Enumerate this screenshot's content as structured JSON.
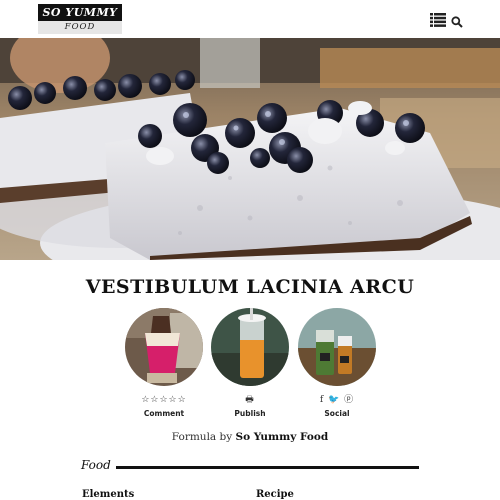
{
  "header": {
    "logo_top": "SO YUMMY",
    "logo_bottom": "FOOD",
    "menu_icon": "list-menu-icon",
    "search_icon": "search-icon"
  },
  "hero": {
    "image": "blueberry-cheesecake-slice-photo"
  },
  "post": {
    "title": "VESTIBULUM LACINIA ARCU"
  },
  "thumbnails": [
    {
      "name": "dessert-cup-thumbnail"
    },
    {
      "name": "iced-coffee-thumbnail"
    },
    {
      "name": "drinks-thumbnail"
    }
  ],
  "actions": [
    {
      "icons": "☆☆☆☆☆",
      "label": "Comment"
    },
    {
      "icons": "🖶",
      "label": "Publish"
    },
    {
      "icons": "f 🐦 ⓟ",
      "label": "Social"
    }
  ],
  "formula": {
    "prefix": "Formula by",
    "brand": "So Yummy Food"
  },
  "food_section": {
    "label": "Food"
  },
  "sections": {
    "elements": "Elements",
    "recipe": "Recipe"
  },
  "colors": {
    "text": "#111111",
    "logo_bg": "#111111",
    "logo_sub_bg": "#e6e6e6"
  }
}
